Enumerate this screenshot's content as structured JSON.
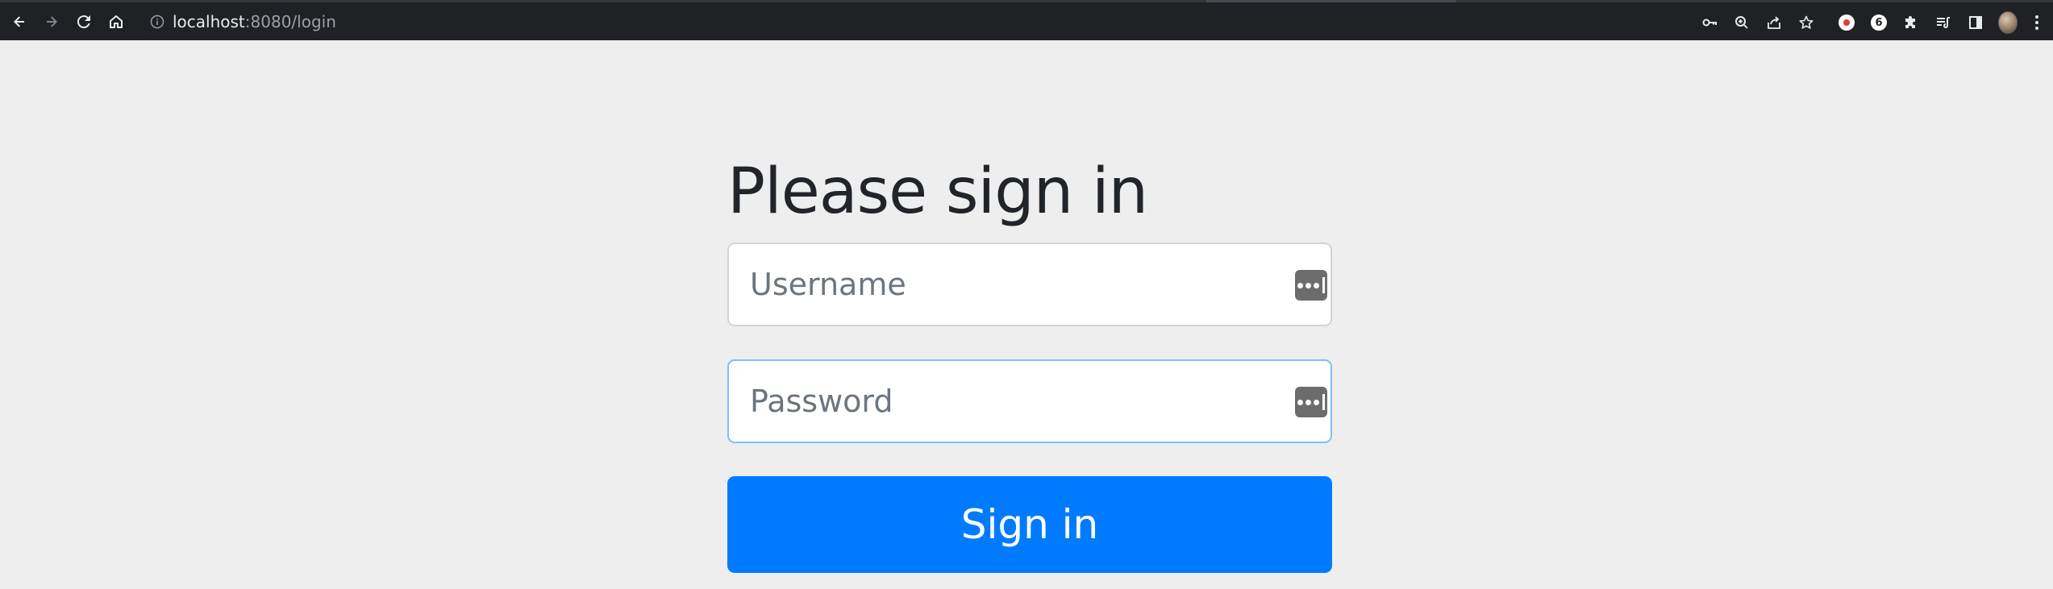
{
  "browser": {
    "url_host": "localhost",
    "url_path": ":8080/login",
    "icons": {
      "back": "arrow-left-icon",
      "forward": "arrow-right-icon",
      "reload": "reload-icon",
      "home": "home-icon",
      "site_info": "info-icon",
      "password_key": "key-icon",
      "zoom": "zoom-icon",
      "share": "share-icon",
      "bookmark": "star-icon",
      "extension_record": "record-extension-icon",
      "extension_letter": "6",
      "extensions": "puzzle-icon",
      "reading_list": "reading-list-icon",
      "side_panel": "side-panel-icon",
      "profile": "avatar",
      "menu": "kebab-menu-icon"
    }
  },
  "login": {
    "heading": "Please sign in",
    "username_placeholder": "Username",
    "password_placeholder": "Password",
    "submit_label": "Sign in"
  },
  "colors": {
    "page_background": "#eeeeee",
    "primary_button": "#007bff",
    "focus_border": "#80bdff",
    "heading_text": "#212529",
    "placeholder_text": "#6c757d"
  }
}
